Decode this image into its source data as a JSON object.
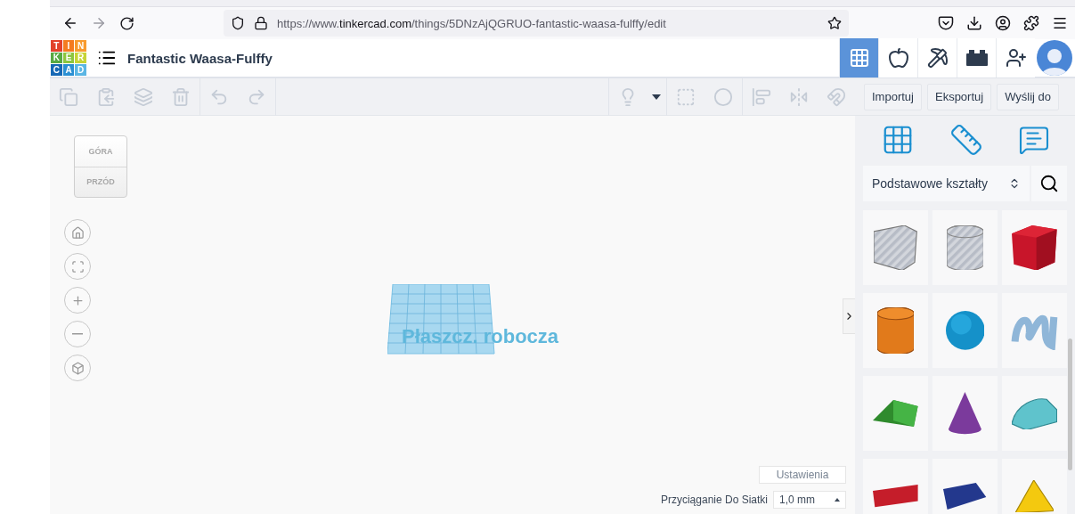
{
  "browser": {
    "url_start": "https://www.",
    "url_host": "tinkercad.com",
    "url_rest": "/things/5DNzAjQGRUO-fantastic-waasa-fulffy/edit"
  },
  "logo": {
    "letters": [
      "T",
      "I",
      "N",
      "K",
      "E",
      "R",
      "C",
      "A",
      "D"
    ]
  },
  "project": {
    "title": "Fantastic Waasa-Fulffy"
  },
  "view_modes": [
    {
      "kind": "grid",
      "selected": true
    },
    {
      "kind": "physics",
      "selected": false
    },
    {
      "kind": "pickaxe",
      "selected": false
    },
    {
      "kind": "bricks",
      "selected": false
    }
  ],
  "actions": [
    "Importuj",
    "Eksportuj",
    "Wyślij do"
  ],
  "view_cube": {
    "top": "GÓRA",
    "front": "PRZÓD"
  },
  "workplane": {
    "label": "Płaszcz. robocza"
  },
  "shapes_panel": {
    "category": "Podstawowe kształty",
    "shapes": [
      {
        "kind": "box-hole"
      },
      {
        "kind": "cylinder-hole"
      },
      {
        "kind": "box"
      },
      {
        "kind": "cylinder"
      },
      {
        "kind": "sphere"
      },
      {
        "kind": "scribble"
      },
      {
        "kind": "roof"
      },
      {
        "kind": "cone"
      },
      {
        "kind": "round-roof"
      },
      {
        "kind": "text"
      },
      {
        "kind": "wedge"
      },
      {
        "kind": "pyramid"
      }
    ]
  },
  "settings_button": "Ustawienia",
  "snap": {
    "label": "Przyciąganie Do Siatki",
    "value": "1,0 mm"
  }
}
